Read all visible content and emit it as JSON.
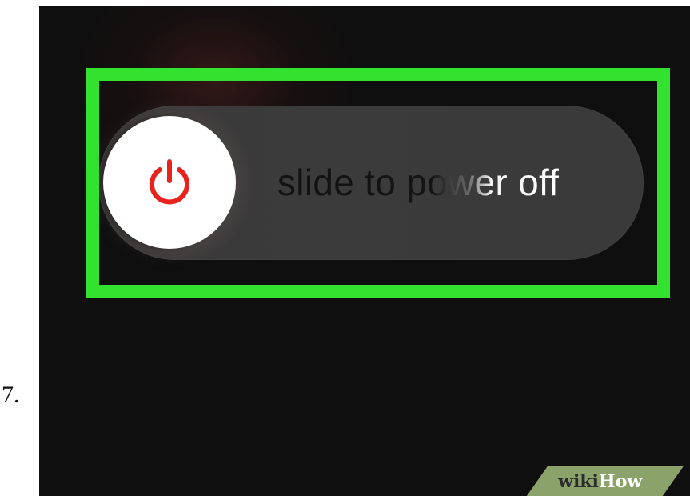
{
  "step": {
    "number": "7."
  },
  "lock_screen": {
    "slider": {
      "label": "slide to power off",
      "knob_icon": "power-icon",
      "icon_color": "#e8221c"
    },
    "highlight_color": "#33e12f",
    "background_color": "#0f0f0f"
  },
  "watermark": {
    "wiki": "wiki",
    "how": "How"
  }
}
